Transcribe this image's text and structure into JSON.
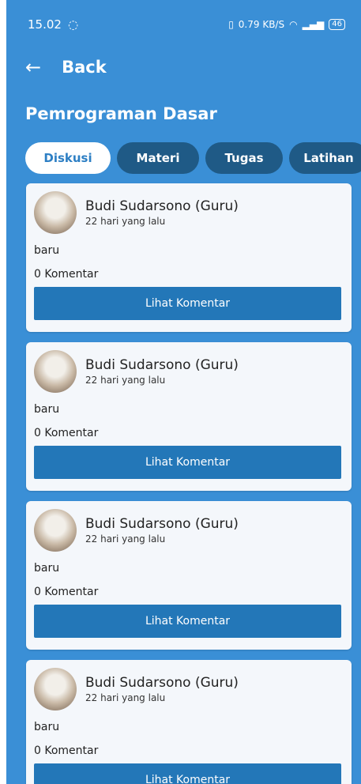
{
  "status_bar": {
    "time": "15.02",
    "whatsapp_icon": "whatsapp-icon",
    "speed": "0.79 KB/S",
    "battery": "46"
  },
  "header": {
    "back_label": "Back",
    "title": "Pemrograman Dasar"
  },
  "tabs": [
    {
      "label": "Diskusi"
    },
    {
      "label": "Materi"
    },
    {
      "label": "Tugas"
    },
    {
      "label": "Latihan"
    }
  ],
  "posts": [
    {
      "author": "Budi Sudarsono (Guru)",
      "time": "22 hari yang lalu",
      "content": "baru",
      "comments": "0 Komentar",
      "button": "Lihat Komentar"
    },
    {
      "author": "Budi Sudarsono (Guru)",
      "time": "22 hari yang lalu",
      "content": "baru",
      "comments": "0 Komentar",
      "button": "Lihat Komentar"
    },
    {
      "author": "Budi Sudarsono (Guru)",
      "time": "22 hari yang lalu",
      "content": "baru",
      "comments": "0 Komentar",
      "button": "Lihat Komentar"
    },
    {
      "author": "Budi Sudarsono (Guru)",
      "time": "22 hari yang lalu",
      "content": "baru",
      "comments": "0 Komentar",
      "button": "Lihat Komentar"
    }
  ],
  "colors": {
    "background": "#3a8fd6",
    "tab_inactive": "#1f5a86",
    "button": "#2377b8",
    "card": "#f4f7fb"
  }
}
